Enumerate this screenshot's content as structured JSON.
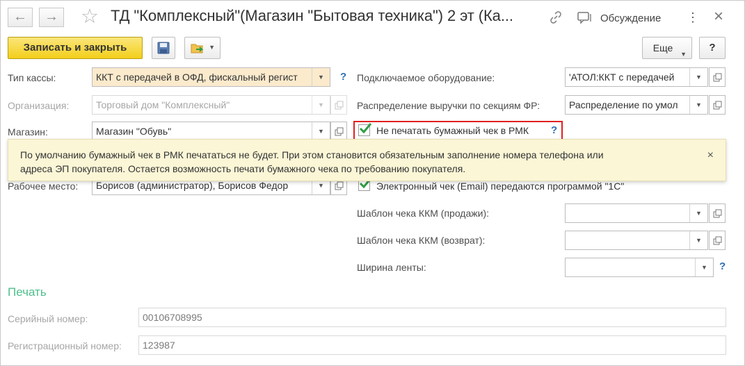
{
  "window": {
    "title": "ТД \"Комплексный\"(Магазин \"Бытовая техника\") 2 эт (Ка...",
    "discussion_label": "Обсуждение"
  },
  "toolbar": {
    "save_close_label": "Записать и закрыть",
    "more_label": "Еще",
    "help_label": "?"
  },
  "form": {
    "cash_type": {
      "label": "Тип кассы:",
      "value": "ККТ с передачей в ОФД, фискальный регист"
    },
    "organization": {
      "label": "Организация:",
      "value": "Торговый дом \"Комплексный\""
    },
    "store": {
      "label": "Магазин:",
      "value": "Магазин \"Обувь\""
    },
    "workplace": {
      "label": "Рабочее место:",
      "value": "Борисов (администратор), Борисов Федор"
    },
    "equipment": {
      "label": "Подключаемое оборудование:",
      "value": "'АТОЛ:ККТ с передачей"
    },
    "revenue_split": {
      "label": "Распределение выручки по секциям ФР:",
      "value": "Распределение по умол"
    },
    "no_paper_receipt": {
      "label": "Не печатать бумажный чек в РМК",
      "checked": true
    },
    "email_receipt": {
      "label": "Электронный чек (Email) передаются программой \"1С\"",
      "checked": true
    },
    "receipt_template_sale": {
      "label": "Шаблон чека ККМ (продажи):",
      "value": ""
    },
    "receipt_template_return": {
      "label": "Шаблон чека ККМ (возврат):",
      "value": ""
    },
    "tape_width": {
      "label": "Ширина ленты:",
      "value": ""
    },
    "help_mark": "?"
  },
  "tooltip": {
    "line1": "По умолчанию бумажный чек в РМК печататься не будет. При этом становится обязательным заполнение номера телефона или",
    "line2": "адреса ЭП покупателя. Остается возможность печати бумажного чека по требованию покупателя.",
    "close": "×"
  },
  "print_section": {
    "title": "Печать",
    "serial": {
      "label": "Серийный номер:",
      "value": "00106708995"
    },
    "registration": {
      "label": "Регистрационный номер:",
      "value": "123987"
    }
  },
  "colors": {
    "primary_button": "#f3cf1b",
    "highlight_field": "#fbeacc",
    "tooltip_bg": "#fbf6d6",
    "section_title": "#4fbf8a",
    "help_blue": "#2d6fb5",
    "check_green": "#2f9e44",
    "callout_red": "#e02020"
  }
}
